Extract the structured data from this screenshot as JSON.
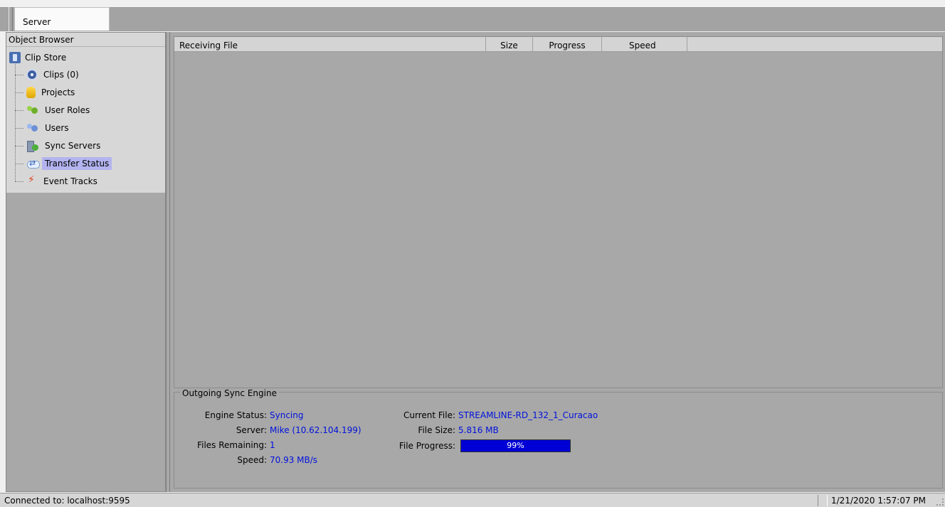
{
  "tabs": [
    {
      "label": "Server"
    }
  ],
  "object_browser": {
    "title": "Object Browser",
    "root": {
      "label": "Clip Store",
      "icon": "clip-store-icon"
    },
    "items": [
      {
        "label": "Clips (0)",
        "icon": "clips-icon"
      },
      {
        "label": "Projects",
        "icon": "projects-icon"
      },
      {
        "label": "User Roles",
        "icon": "user-roles-icon"
      },
      {
        "label": "Users",
        "icon": "users-icon"
      },
      {
        "label": "Sync Servers",
        "icon": "sync-servers-icon"
      },
      {
        "label": "Transfer Status",
        "icon": "transfer-status-icon",
        "selected": true
      },
      {
        "label": "Event Tracks",
        "icon": "event-tracks-icon"
      }
    ]
  },
  "receiving_table": {
    "columns": [
      "Receiving File",
      "Size",
      "Progress",
      "Speed"
    ],
    "rows": []
  },
  "outgoing": {
    "title": "Outgoing Sync Engine",
    "engine_status_label": "Engine Status:",
    "engine_status": "Syncing",
    "server_label": "Server:",
    "server": "Mike (10.62.104.199)",
    "files_remaining_label": "Files Remaining:",
    "files_remaining": "1",
    "speed_label": "Speed:",
    "speed": "70.93 MB/s",
    "current_file_label": "Current File:",
    "current_file": "STREAMLINE-RD_132_1_Curacao",
    "file_size_label": "File Size:",
    "file_size": "5.816 MB",
    "file_progress_label": "File Progress:",
    "file_progress_text": "99%",
    "file_progress_fraction": 0.99
  },
  "status_bar": {
    "connection": "Connected to: localhost:9595",
    "datetime": "1/21/2020 1:57:07 PM"
  },
  "colors": {
    "value_text": "#0011dd",
    "progress_fill": "#0000d6",
    "selection": "#b3b3ef"
  }
}
